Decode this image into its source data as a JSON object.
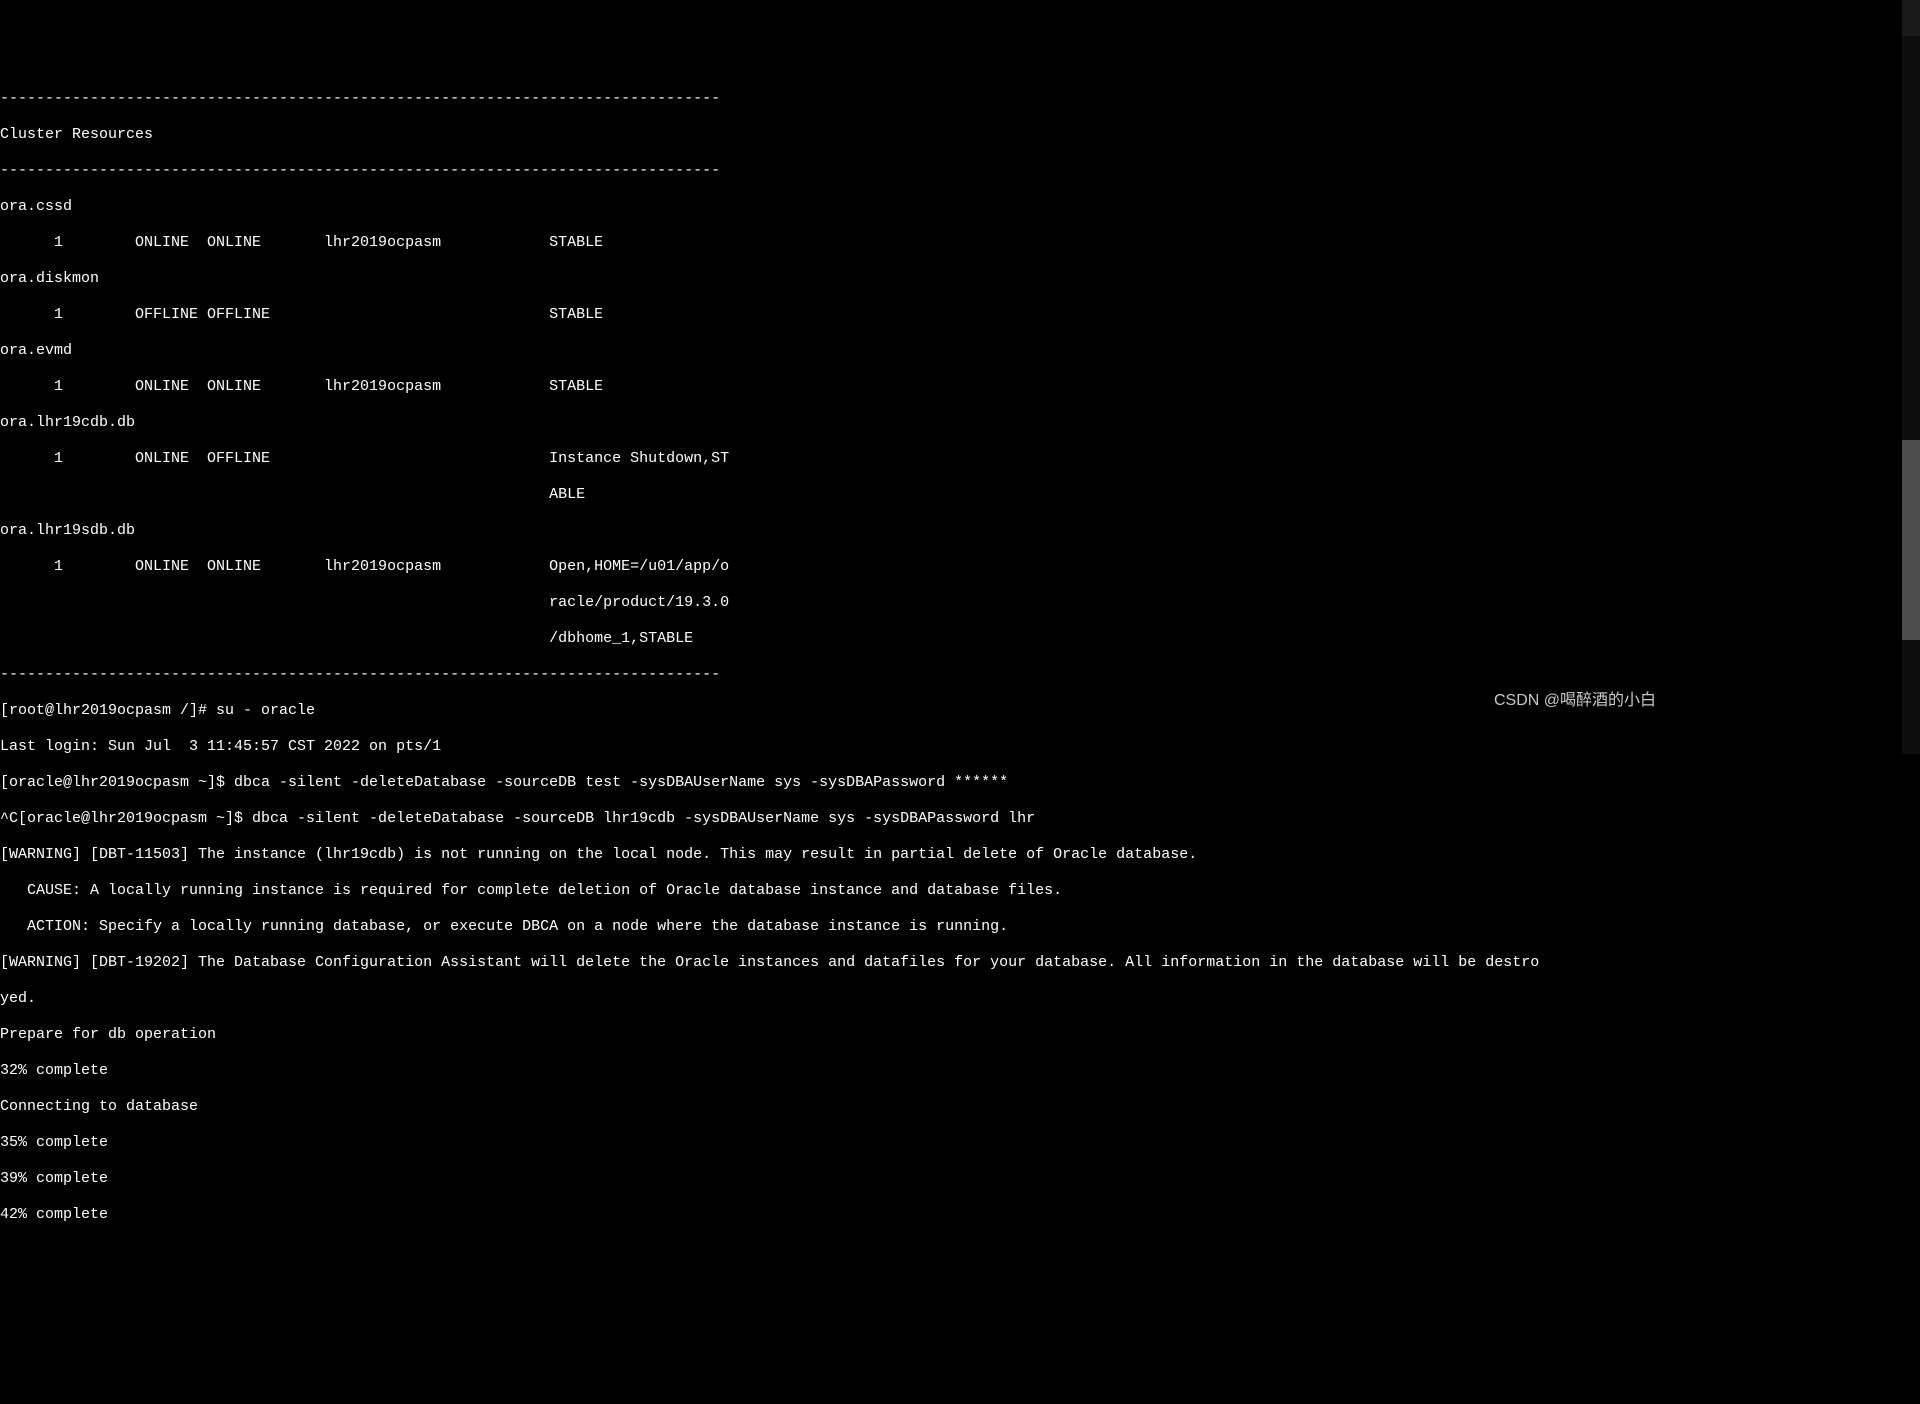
{
  "lines": [
    "--------------------------------------------------------------------------------",
    "Cluster Resources",
    "--------------------------------------------------------------------------------",
    "ora.cssd",
    "      1        ONLINE  ONLINE       lhr2019ocpasm            STABLE",
    "ora.diskmon",
    "      1        OFFLINE OFFLINE                               STABLE",
    "ora.evmd",
    "      1        ONLINE  ONLINE       lhr2019ocpasm            STABLE",
    "ora.lhr19cdb.db",
    "      1        ONLINE  OFFLINE                               Instance Shutdown,ST",
    "                                                             ABLE",
    "ora.lhr19sdb.db",
    "      1        ONLINE  ONLINE       lhr2019ocpasm            Open,HOME=/u01/app/o",
    "                                                             racle/product/19.3.0",
    "                                                             /dbhome_1,STABLE",
    "--------------------------------------------------------------------------------",
    "[root@lhr2019ocpasm /]# su - oracle",
    "Last login: Sun Jul  3 11:45:57 CST 2022 on pts/1",
    "[oracle@lhr2019ocpasm ~]$ dbca -silent -deleteDatabase -sourceDB test -sysDBAUserName sys -sysDBAPassword ******",
    "^C[oracle@lhr2019ocpasm ~]$ dbca -silent -deleteDatabase -sourceDB lhr19cdb -sysDBAUserName sys -sysDBAPassword lhr",
    "[WARNING] [DBT-11503] The instance (lhr19cdb) is not running on the local node. This may result in partial delete of Oracle database.",
    "   CAUSE: A locally running instance is required for complete deletion of Oracle database instance and database files.",
    "   ACTION: Specify a locally running database, or execute DBCA on a node where the database instance is running.",
    "[WARNING] [DBT-19202] The Database Configuration Assistant will delete the Oracle instances and datafiles for your database. All information in the database will be destro",
    "yed.",
    "Prepare for db operation",
    "32% complete",
    "Connecting to database",
    "35% complete",
    "39% complete",
    "42% complete"
  ],
  "watermark": "CSDN @喝醉酒的小白"
}
